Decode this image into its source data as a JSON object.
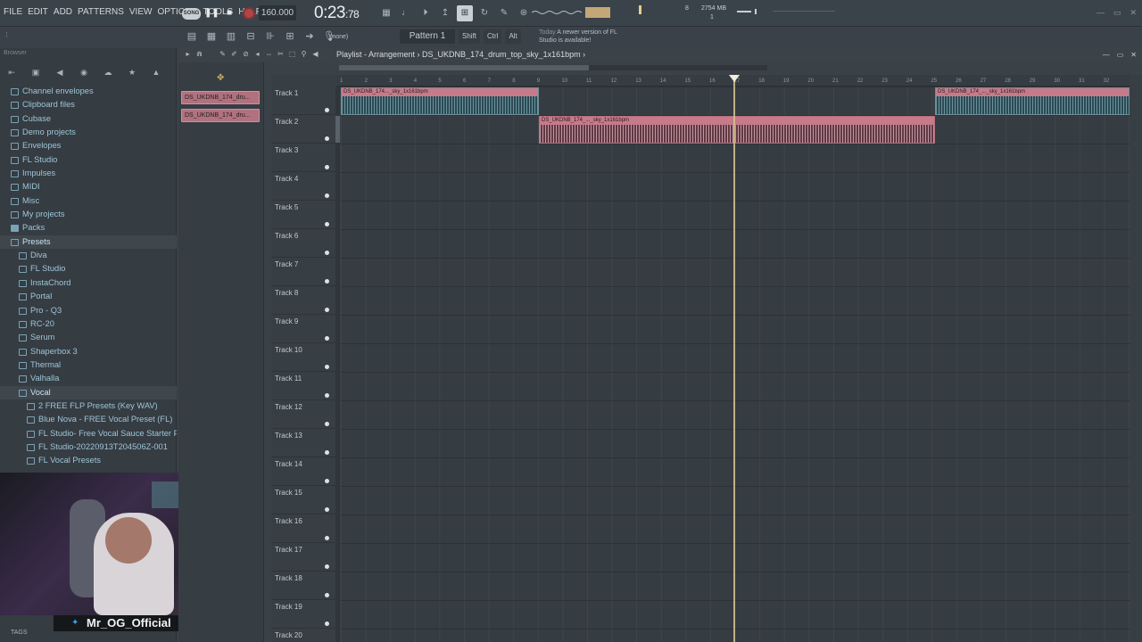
{
  "menubar": {
    "items": [
      "FILE",
      "EDIT",
      "ADD",
      "PATTERNS",
      "VIEW",
      "OPTIONS",
      "TOOLS",
      "HELP"
    ]
  },
  "transport": {
    "mode_label": "SONG",
    "tempo": "160.000",
    "time_main": "0:23",
    "time_sub": ":78",
    "memory": "2754 MB",
    "cpu": "8",
    "voices": "1"
  },
  "toolbar": {
    "snap_label": "(none)",
    "pattern_label": "Pattern 1",
    "modifiers": [
      "Shift",
      "Ctrl",
      "Alt"
    ],
    "news_date": "Today",
    "news_text": "A newer version of FL Studio is available!"
  },
  "browser": {
    "title": "Browser",
    "tags_label": "TAGS",
    "items": [
      {
        "label": "Channel envelopes",
        "level": 0,
        "type": "folder"
      },
      {
        "label": "Clipboard files",
        "level": 0,
        "type": "folder"
      },
      {
        "label": "Cubase",
        "level": 0,
        "type": "folder"
      },
      {
        "label": "Demo projects",
        "level": 0,
        "type": "folder"
      },
      {
        "label": "Envelopes",
        "level": 0,
        "type": "folder"
      },
      {
        "label": "FL Studio",
        "level": 0,
        "type": "folder"
      },
      {
        "label": "Impulses",
        "level": 0,
        "type": "folder"
      },
      {
        "label": "MIDI",
        "level": 0,
        "type": "folder"
      },
      {
        "label": "Misc",
        "level": 0,
        "type": "folder"
      },
      {
        "label": "My projects",
        "level": 0,
        "type": "folder"
      },
      {
        "label": "Packs",
        "level": 0,
        "type": "pack"
      },
      {
        "label": "Presets",
        "level": 0,
        "type": "open"
      },
      {
        "label": "Diva",
        "level": 1,
        "type": "folder"
      },
      {
        "label": "FL Studio",
        "level": 1,
        "type": "folder"
      },
      {
        "label": "InstaChord",
        "level": 1,
        "type": "folder"
      },
      {
        "label": "Portal",
        "level": 1,
        "type": "folder"
      },
      {
        "label": "Pro - Q3",
        "level": 1,
        "type": "folder"
      },
      {
        "label": "RC-20",
        "level": 1,
        "type": "folder"
      },
      {
        "label": "Serum",
        "level": 1,
        "type": "folder"
      },
      {
        "label": "Shaperbox 3",
        "level": 1,
        "type": "folder"
      },
      {
        "label": "Thermal",
        "level": 1,
        "type": "folder"
      },
      {
        "label": "Valhalla",
        "level": 1,
        "type": "folder"
      },
      {
        "label": "Vocal",
        "level": 1,
        "type": "open"
      },
      {
        "label": "2 FREE FLP Presets (Key WAV)",
        "level": 2,
        "type": "folder"
      },
      {
        "label": "Blue Nova - FREE Vocal Preset (FL)",
        "level": 2,
        "type": "folder"
      },
      {
        "label": "FL Studio- Free Vocal Sauce Starter Pack",
        "level": 2,
        "type": "folder"
      },
      {
        "label": "FL Studio-20220913T204506Z-001",
        "level": 2,
        "type": "folder"
      },
      {
        "label": "FL Vocal Presets",
        "level": 2,
        "type": "folder"
      }
    ]
  },
  "webcam": {
    "handle": "Mr_OG_Official"
  },
  "playlist": {
    "title": "Playlist - Arrangement",
    "arrangement_file": "DS_UKDNB_174_drum_top_sky_1x161bpm",
    "clip_list": [
      "DS_UKDNB_174_dru...",
      "DS_UKDNB_174_dru..."
    ],
    "ruler": [
      "1",
      "2",
      "3",
      "4",
      "5",
      "6",
      "7",
      "8",
      "9",
      "10",
      "11",
      "12",
      "13",
      "14",
      "15",
      "16",
      "17",
      "18",
      "19",
      "20",
      "21",
      "22",
      "23",
      "24",
      "25",
      "26",
      "27",
      "28",
      "29",
      "30",
      "31",
      "32"
    ],
    "tracks": [
      "Track 1",
      "Track 2",
      "Track 3",
      "Track 4",
      "Track 5",
      "Track 6",
      "Track 7",
      "Track 8",
      "Track 9",
      "Track 10",
      "Track 11",
      "Track 12",
      "Track 13",
      "Track 14",
      "Track 15",
      "Track 16",
      "Track 17",
      "Track 18",
      "Track 19",
      "Track 20"
    ],
    "clip_label_1": "DS_UKDNB_174..._sky_1x161bpm",
    "clip_label_2": "DS_UKDNB_174_..._sky_1x161bpm",
    "clip_label_3": "DS_UKDNB_174_..._sky_1x161bpm",
    "playhead_bar": 17,
    "colors": {
      "clip_accent": "#c77a8a",
      "playhead": "#d6c38f",
      "link": "#9fc5d8"
    }
  }
}
